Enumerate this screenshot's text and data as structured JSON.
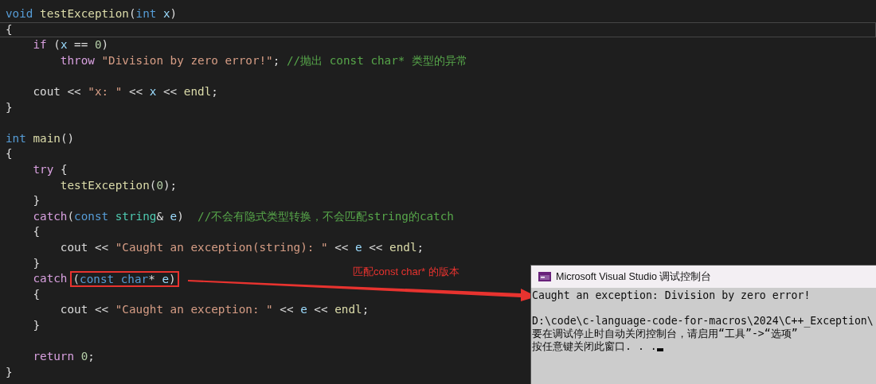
{
  "editor": {
    "lines": [
      {
        "current": false,
        "tokens": [
          {
            "kind": "kw",
            "text": "void "
          },
          {
            "kind": "fn",
            "text": "testException"
          },
          {
            "kind": "p",
            "text": "("
          },
          {
            "kind": "kw",
            "text": "int "
          },
          {
            "kind": "param",
            "text": "x"
          },
          {
            "kind": "p",
            "text": ")"
          }
        ]
      },
      {
        "current": true,
        "tokens": [
          {
            "kind": "p",
            "text": "{"
          }
        ]
      },
      {
        "current": false,
        "tokens": [
          {
            "kind": "ctrl",
            "text": "    if "
          },
          {
            "kind": "p",
            "text": "("
          },
          {
            "kind": "param",
            "text": "x"
          },
          {
            "kind": "p",
            "text": " == "
          },
          {
            "kind": "num",
            "text": "0"
          },
          {
            "kind": "p",
            "text": ")"
          }
        ]
      },
      {
        "current": false,
        "tokens": [
          {
            "kind": "ctrl",
            "text": "        throw "
          },
          {
            "kind": "str",
            "text": "\"Division by zero error!\""
          },
          {
            "kind": "p",
            "text": "; "
          },
          {
            "kind": "cm",
            "text": "//抛出 const char* 类型的异常"
          }
        ]
      },
      {
        "current": false
      },
      {
        "current": false,
        "tokens": [
          {
            "kind": "p",
            "text": "    cout << "
          },
          {
            "kind": "str",
            "text": "\"x: \""
          },
          {
            "kind": "p",
            "text": " << "
          },
          {
            "kind": "param",
            "text": "x"
          },
          {
            "kind": "p",
            "text": " << "
          },
          {
            "kind": "fn",
            "text": "endl"
          },
          {
            "kind": "p",
            "text": ";"
          }
        ]
      },
      {
        "current": false,
        "tokens": [
          {
            "kind": "p",
            "text": "}"
          }
        ]
      },
      {
        "current": false
      },
      {
        "current": false,
        "tokens": [
          {
            "kind": "kw",
            "text": "int "
          },
          {
            "kind": "fn",
            "text": "main"
          },
          {
            "kind": "p",
            "text": "()"
          }
        ]
      },
      {
        "current": false,
        "tokens": [
          {
            "kind": "p",
            "text": "{"
          }
        ]
      },
      {
        "current": false,
        "tokens": [
          {
            "kind": "ctrl",
            "text": "    try "
          },
          {
            "kind": "p",
            "text": "{"
          }
        ]
      },
      {
        "current": false,
        "tokens": [
          {
            "kind": "fn",
            "text": "        testException"
          },
          {
            "kind": "p",
            "text": "("
          },
          {
            "kind": "num",
            "text": "0"
          },
          {
            "kind": "p",
            "text": ");"
          }
        ]
      },
      {
        "current": false,
        "tokens": [
          {
            "kind": "p",
            "text": "    }"
          }
        ]
      },
      {
        "current": false,
        "tokens": [
          {
            "kind": "ctrl",
            "text": "    catch"
          },
          {
            "kind": "p",
            "text": "("
          },
          {
            "kind": "kw",
            "text": "const "
          },
          {
            "kind": "type",
            "text": "string"
          },
          {
            "kind": "p",
            "text": "& "
          },
          {
            "kind": "param",
            "text": "e"
          },
          {
            "kind": "p",
            "text": ")  "
          },
          {
            "kind": "cm",
            "text": "//不会有隐式类型转换，不会匹配string的catch"
          }
        ]
      },
      {
        "current": false,
        "tokens": [
          {
            "kind": "p",
            "text": "    {"
          }
        ]
      },
      {
        "current": false,
        "tokens": [
          {
            "kind": "p",
            "text": "        cout << "
          },
          {
            "kind": "str",
            "text": "\"Caught an exception(string): \""
          },
          {
            "kind": "p",
            "text": " << "
          },
          {
            "kind": "param",
            "text": "e"
          },
          {
            "kind": "p",
            "text": " << "
          },
          {
            "kind": "fn",
            "text": "endl"
          },
          {
            "kind": "p",
            "text": ";"
          }
        ]
      },
      {
        "current": false,
        "tokens": [
          {
            "kind": "p",
            "text": "    }"
          }
        ]
      },
      {
        "current": false,
        "tokens": [
          {
            "kind": "ctrl",
            "text": "    catch"
          }
        ],
        "boxed_tokens": [
          {
            "kind": "p",
            "text": "("
          },
          {
            "kind": "kw",
            "text": "const char"
          },
          {
            "kind": "p",
            "text": "* "
          },
          {
            "kind": "param",
            "text": "e"
          },
          {
            "kind": "p",
            "text": ")"
          }
        ]
      },
      {
        "current": false,
        "tokens": [
          {
            "kind": "p",
            "text": "    {"
          }
        ]
      },
      {
        "current": false,
        "tokens": [
          {
            "kind": "p",
            "text": "        cout << "
          },
          {
            "kind": "str",
            "text": "\"Caught an exception: \""
          },
          {
            "kind": "p",
            "text": " << "
          },
          {
            "kind": "param",
            "text": "e"
          },
          {
            "kind": "p",
            "text": " << "
          },
          {
            "kind": "fn",
            "text": "endl"
          },
          {
            "kind": "p",
            "text": ";"
          }
        ]
      },
      {
        "current": false,
        "tokens": [
          {
            "kind": "p",
            "text": "    }"
          }
        ]
      },
      {
        "current": false
      },
      {
        "current": false,
        "tokens": [
          {
            "kind": "ctrl",
            "text": "    return "
          },
          {
            "kind": "num",
            "text": "0"
          },
          {
            "kind": "p",
            "text": ";"
          }
        ]
      },
      {
        "current": false,
        "tokens": [
          {
            "kind": "p",
            "text": "}"
          }
        ]
      }
    ]
  },
  "annotation": {
    "label": "匹配const char* 的版本"
  },
  "console": {
    "title": "Microsoft Visual Studio 调试控制台",
    "blocks": [
      [
        "Caught an exception: Division by zero error!"
      ],
      [
        "D:\\code\\c-language-code-for-macros\\2024\\C++_Exception\\",
        "要在调试停止时自动关闭控制台，请启用“工具”->“选项”",
        "按任意键关闭此窗口. . ."
      ]
    ]
  }
}
